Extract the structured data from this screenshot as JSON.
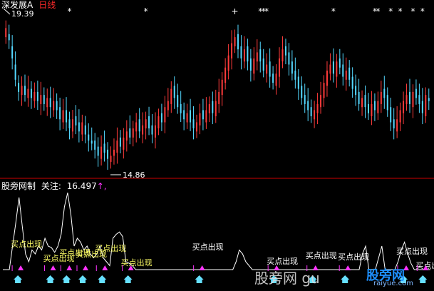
{
  "top_panel": {
    "stock_name": "深发展A",
    "period": "日线",
    "high_label": "19.39",
    "low_label": "14.86"
  },
  "bottom_panel": {
    "indicator": "股旁网制",
    "focus_label": "关注:",
    "focus_value": "16.497",
    "focus_arrow": "↑,"
  },
  "watermark": {
    "main": "股旁网 gu",
    "site": "股旁网",
    "url": "raiyue.com"
  },
  "colors": {
    "up": "#ff3b3b",
    "down": "#54d8ff",
    "line": "#ffffff",
    "signal_text": "#ffff66",
    "marker": "#ff33ff",
    "house": "#66e0ff"
  },
  "chart_data": [
    {
      "type": "candlestick",
      "title": "深发展A 日线",
      "high": 19.39,
      "low": 14.86,
      "ylim": [
        14.5,
        19.8
      ],
      "top_markers": [
        "*",
        "*",
        "+",
        "*",
        "*",
        "*",
        "*",
        "*",
        "*",
        "*",
        "*",
        "*",
        "*"
      ],
      "closes": [
        19.3,
        18.9,
        18.3,
        17.6,
        17.2,
        17.4,
        17.1,
        17.3,
        17.0,
        17.2,
        16.9,
        17.1,
        16.8,
        17.0,
        16.7,
        16.9,
        16.6,
        16.3,
        16.6,
        16.2,
        16.0,
        16.3,
        16.1,
        15.9,
        16.2,
        15.8,
        15.6,
        15.5,
        15.3,
        15.1,
        15.4,
        15.2,
        15.0,
        15.1,
        15.3,
        15.6,
        15.4,
        15.7,
        15.9,
        15.7,
        16.0,
        16.2,
        15.9,
        16.1,
        16.3,
        16.0,
        15.8,
        16.1,
        16.4,
        16.2,
        16.7,
        16.9,
        17.3,
        17.0,
        16.7,
        16.5,
        16.3,
        16.5,
        16.2,
        16.0,
        16.2,
        16.5,
        16.3,
        16.6,
        16.8,
        16.5,
        16.9,
        17.2,
        17.6,
        18.0,
        18.4,
        18.8,
        19.0,
        18.6,
        18.3,
        18.6,
        18.2,
        17.9,
        18.3,
        18.5,
        18.2,
        17.9,
        18.1,
        17.7,
        17.5,
        17.8,
        18.3,
        18.6,
        18.4,
        18.1,
        17.8,
        17.6,
        17.3,
        17.0,
        16.8,
        16.6,
        16.4,
        16.6,
        16.8,
        17.1,
        17.5,
        17.9,
        18.1,
        17.8,
        18.2,
        18.0,
        17.7,
        17.9,
        17.6,
        17.3,
        17.1,
        16.8,
        17.0,
        16.7,
        16.5,
        16.8,
        16.6,
        16.9,
        17.2,
        17.0,
        16.6,
        16.2,
        16.0,
        16.3,
        16.6,
        16.9,
        17.1,
        16.8,
        17.2,
        17.0,
        16.8,
        16.5,
        17.1,
        16.9
      ],
      "opens": [
        19.0,
        19.1,
        18.7,
        18.1,
        17.5,
        17.1,
        17.4,
        17.0,
        17.3,
        16.9,
        17.2,
        16.8,
        17.1,
        16.7,
        17.0,
        16.6,
        16.9,
        16.7,
        16.2,
        16.6,
        16.3,
        15.9,
        16.4,
        16.2,
        15.8,
        16.1,
        15.8,
        15.6,
        15.6,
        15.4,
        15.0,
        15.5,
        15.3,
        14.9,
        15.1,
        15.2,
        15.7,
        15.3,
        15.6,
        16.0,
        15.7,
        15.9,
        16.3,
        15.8,
        16.0,
        16.4,
        16.1,
        15.7,
        16.0,
        16.5,
        16.2,
        16.6,
        16.8,
        17.4,
        17.1,
        16.8,
        16.6,
        16.2,
        16.6,
        16.3,
        15.9,
        16.1,
        16.6,
        16.2,
        16.5,
        16.9,
        16.4,
        16.8,
        17.1,
        17.5,
        17.9,
        18.3,
        18.7,
        19.1,
        18.7,
        18.2,
        18.7,
        18.3,
        17.8,
        18.2,
        18.6,
        18.3,
        17.8,
        18.2,
        17.8,
        17.4,
        17.7,
        18.2,
        18.7,
        18.5,
        18.2,
        17.9,
        17.7,
        17.4,
        17.1,
        16.9,
        16.7,
        16.3,
        16.5,
        16.7,
        17.0,
        17.4,
        17.8,
        18.2,
        17.7,
        18.3,
        18.1,
        17.6,
        18.0,
        17.7,
        17.4,
        17.2,
        16.7,
        17.1,
        16.8,
        16.4,
        16.9,
        16.5,
        16.8,
        17.3,
        17.1,
        16.7,
        16.3,
        15.9,
        16.2,
        16.5,
        16.8,
        17.2,
        16.7,
        17.3,
        17.1,
        16.9,
        16.4,
        17.0
      ]
    },
    {
      "type": "line",
      "title": "股旁网制",
      "focus_value": 16.497,
      "ylim": [
        0,
        100
      ],
      "values": [
        0,
        0,
        0,
        30,
        60,
        92,
        55,
        20,
        10,
        25,
        20,
        30,
        25,
        40,
        30,
        28,
        22,
        30,
        45,
        80,
        98,
        70,
        30,
        40,
        35,
        25,
        30,
        20,
        15,
        20,
        30,
        15,
        10,
        5,
        40,
        45,
        48,
        42,
        10,
        8,
        5,
        0,
        0,
        0,
        0,
        0,
        0,
        0,
        0,
        0,
        0,
        0,
        0,
        0,
        0,
        0,
        0,
        0,
        0,
        0,
        0,
        0,
        0,
        0,
        0,
        0,
        0,
        0,
        0,
        0,
        0,
        0,
        10,
        25,
        20,
        10,
        5,
        0,
        0,
        0,
        0,
        0,
        0,
        0,
        0,
        0,
        0,
        0,
        0,
        0,
        0,
        0,
        0,
        0,
        0,
        0,
        0,
        0,
        0,
        0,
        0,
        0,
        0,
        0,
        0,
        0,
        0,
        0,
        0,
        0,
        0,
        20,
        30,
        0,
        0,
        0,
        15,
        30,
        0,
        0,
        0,
        0,
        10,
        25,
        35,
        20,
        8,
        0,
        0,
        0,
        0,
        0,
        0
      ],
      "signals": [
        {
          "label": "买点出现",
          "index": 2
        },
        {
          "label": "买点出现",
          "index": 12
        },
        {
          "label": "买点出现",
          "index": 17
        },
        {
          "label": "买点出现",
          "index": 22
        },
        {
          "label": "买点出现",
          "index": 28
        },
        {
          "label": "买点出现",
          "index": 36
        },
        {
          "label": "买点出现",
          "index": 58
        },
        {
          "label": "买点出现",
          "index": 81
        },
        {
          "label": "买点出现",
          "index": 93
        },
        {
          "label": "买点出现",
          "index": 103
        },
        {
          "label": "买点出现",
          "index": 121
        },
        {
          "label": "买点出现",
          "index": 127
        }
      ]
    }
  ]
}
